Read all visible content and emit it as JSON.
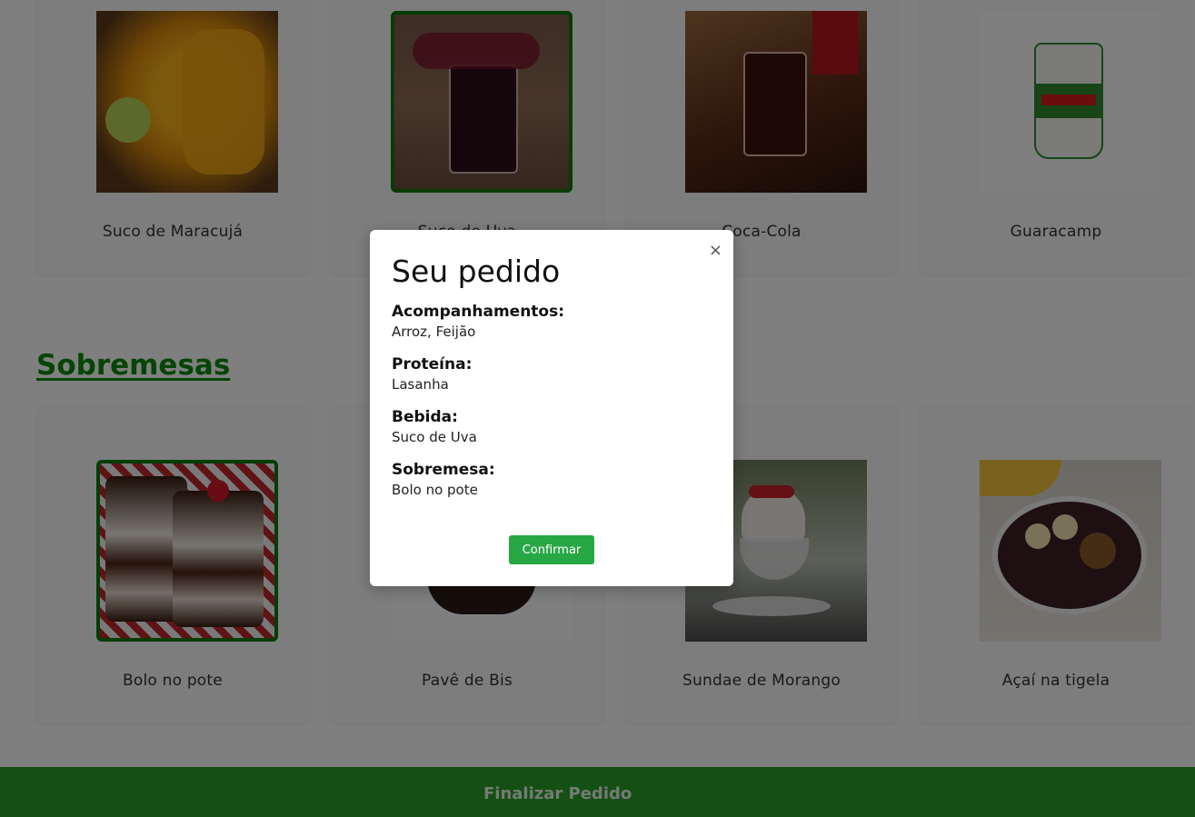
{
  "drinks": [
    {
      "label": "Suco de Maracujá",
      "selected": false,
      "image": "maracuja"
    },
    {
      "label": "Suco de Uva",
      "selected": true,
      "image": "uva"
    },
    {
      "label": "Coca-Cola",
      "selected": false,
      "image": "coca"
    },
    {
      "label": "Guaracamp",
      "selected": false,
      "image": "guaracamp"
    }
  ],
  "desserts_section": {
    "title": "Sobremesas"
  },
  "desserts": [
    {
      "label": "Bolo no pote",
      "selected": true,
      "image": "bolo"
    },
    {
      "label": "Pavê de Bis",
      "selected": false,
      "image": "pave"
    },
    {
      "label": "Sundae de Morango",
      "selected": false,
      "image": "sundae"
    },
    {
      "label": "Açaí na tigela",
      "selected": false,
      "image": "acai"
    }
  ],
  "footer": {
    "finalize_label": "Finalizar Pedido"
  },
  "modal": {
    "title": "Seu pedido",
    "close_glyph": "×",
    "sections": [
      {
        "heading": "Acompanhamentos:",
        "value": "Arroz, Feijão"
      },
      {
        "heading": "Proteína:",
        "value": "Lasanha"
      },
      {
        "heading": "Bebida:",
        "value": "Suco de Uva"
      },
      {
        "heading": "Sobremesa:",
        "value": "Bolo no pote"
      }
    ],
    "confirm_label": "Confirmar"
  },
  "colors": {
    "accent_green": "#28a028",
    "section_title_green": "#0b8a0b",
    "selected_border": "#0b7a0b",
    "confirm_button": "#28a745"
  }
}
